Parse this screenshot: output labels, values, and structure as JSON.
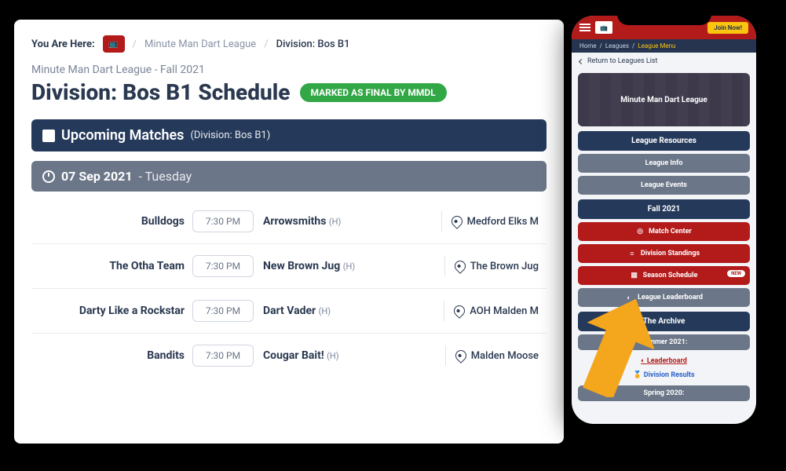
{
  "breadcrumb": {
    "label": "You Are Here:",
    "link1": "Minute Man Dart League",
    "active": "Division: Bos B1"
  },
  "league_name": "Minute Man Dart League - Fall 2021",
  "division_title": "Division: Bos B1 Schedule",
  "final_badge": "MARKED AS FINAL BY MMDL",
  "upcoming": {
    "title": "Upcoming Matches",
    "sub": "(Division: Bos B1)"
  },
  "date_bar": {
    "date": "07 Sep 2021",
    "day": "- Tuesday"
  },
  "matches": [
    {
      "a": "Bulldogs",
      "time": "7:30 PM",
      "b": "Arrowsmiths",
      "h": "(H)",
      "venue": "Medford Elks M"
    },
    {
      "a": "The Otha Team",
      "time": "7:30 PM",
      "b": "New Brown Jug",
      "h": "(H)",
      "venue": "The Brown Jug"
    },
    {
      "a": "Darty Like a Rockstar",
      "time": "7:30 PM",
      "b": "Dart Vader",
      "h": "(H)",
      "venue": "AOH Malden M"
    },
    {
      "a": "Bandits",
      "time": "7:30 PM",
      "b": "Cougar Bait!",
      "h": "(H)",
      "venue": "Malden Moose"
    }
  ],
  "phone": {
    "join": "Join Now!",
    "crumb": {
      "home": "Home",
      "leagues": "Leagues",
      "active": "League Menu"
    },
    "back": "Return to Leagues List",
    "hero": "Minute Man Dart League",
    "resources": "League Resources",
    "info": "League Info",
    "events": "League Events",
    "season": "Fall 2021",
    "match_center": "Match Center",
    "standings": "Division Standings",
    "schedule": "Season Schedule",
    "new_badge": "NEW",
    "leaderboard": "League Leaderboard",
    "archive": "The Archive",
    "summer": "Summer 2021:",
    "arch_leaderboard": "Leaderboard",
    "arch_results": "Division Results",
    "spring": "Spring 2020:"
  }
}
